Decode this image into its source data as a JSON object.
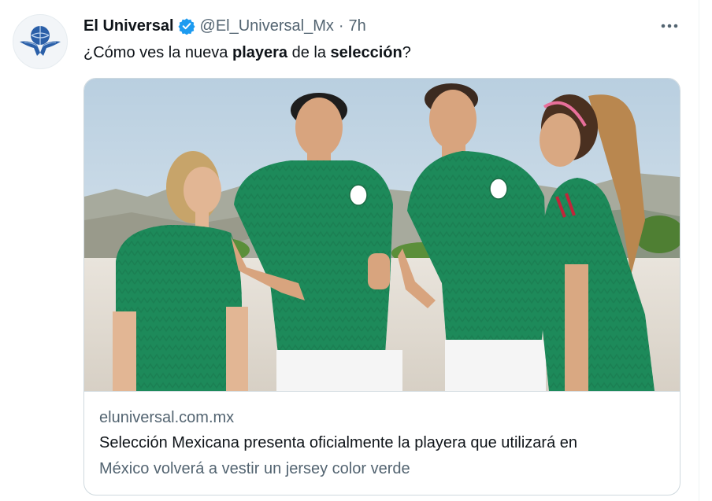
{
  "author": {
    "display_name": "El Universal",
    "handle": "@El_Universal_Mx",
    "separator": "·",
    "time": "7h",
    "verified": true
  },
  "tweet": {
    "text_parts": [
      "¿Cómo ves la nueva ",
      "playera",
      " de la ",
      "selección",
      "?"
    ]
  },
  "card": {
    "domain": "eluniversal.com.mx",
    "title": "Selección Mexicana presenta oficialmente la playera que utilizará en",
    "description": "México volverá a vestir un jersey color verde"
  },
  "colors": {
    "accent": "#1d9bf0",
    "muted": "#536471",
    "border": "#cfd9de",
    "jersey_green": "#1d8a5a"
  },
  "icons": {
    "verified": "verified-badge-icon",
    "more": "more-dots-icon",
    "avatar": "eagle-globe-logo"
  }
}
